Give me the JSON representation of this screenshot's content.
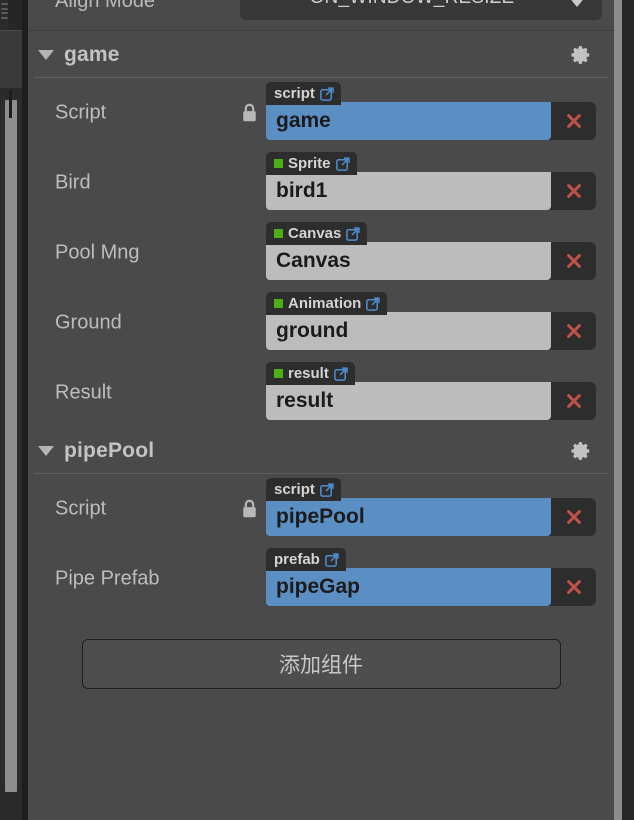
{
  "panel": {
    "name": "inspector-panel",
    "background_color": "#4a4a4a"
  },
  "top_property": {
    "label": "Align Mode",
    "dropdown_value": "ON_WINDOW_RESIZE",
    "caret_icon": "chevron-down-icon"
  },
  "sections": [
    {
      "title": "game",
      "collapsed": false,
      "fold_icon": "caret-down-icon",
      "gear_icon": "gear-icon",
      "rows": [
        {
          "label": "Script",
          "locked": true,
          "lock_icon": "lock-icon",
          "chip_text": "script",
          "chip_has_dot": false,
          "chip_link_icon": "external-link-icon",
          "value": "game",
          "value_style": "blue",
          "clear_icon": "close-x-icon"
        },
        {
          "label": "Bird",
          "locked": false,
          "chip_text": "Sprite",
          "chip_has_dot": true,
          "chip_dot_color": "#4caf16",
          "chip_link_icon": "external-link-icon",
          "value": "bird1",
          "value_style": "grey",
          "clear_icon": "close-x-icon"
        },
        {
          "label": "Pool Mng",
          "locked": false,
          "chip_text": "Canvas",
          "chip_has_dot": true,
          "chip_dot_color": "#4caf16",
          "chip_link_icon": "external-link-icon",
          "value": "Canvas",
          "value_style": "grey",
          "clear_icon": "close-x-icon"
        },
        {
          "label": "Ground",
          "locked": false,
          "chip_text": "Animation",
          "chip_has_dot": true,
          "chip_dot_color": "#4caf16",
          "chip_link_icon": "external-link-icon",
          "value": "ground",
          "value_style": "grey",
          "clear_icon": "close-x-icon"
        },
        {
          "label": "Result",
          "locked": false,
          "chip_text": "result",
          "chip_has_dot": true,
          "chip_dot_color": "#4caf16",
          "chip_link_icon": "external-link-icon",
          "value": "result",
          "value_style": "grey",
          "clear_icon": "close-x-icon"
        }
      ]
    },
    {
      "title": "pipePool",
      "collapsed": false,
      "fold_icon": "caret-down-icon",
      "gear_icon": "gear-icon",
      "rows": [
        {
          "label": "Script",
          "locked": true,
          "lock_icon": "lock-icon",
          "chip_text": "script",
          "chip_has_dot": false,
          "chip_link_icon": "external-link-icon",
          "value": "pipePool",
          "value_style": "blue",
          "clear_icon": "close-x-icon"
        },
        {
          "label": "Pipe Prefab",
          "locked": false,
          "chip_text": "prefab",
          "chip_has_dot": false,
          "chip_link_icon": "external-link-icon",
          "value": "pipeGap",
          "value_style": "blue",
          "clear_icon": "close-x-icon"
        }
      ]
    }
  ],
  "add_component_button": {
    "label": "添加组件"
  },
  "colors": {
    "panel_bg": "#4a4a4a",
    "chip_bg": "#2d2d2d",
    "value_blue": "#5b8fc4",
    "value_grey": "#bcbcbc",
    "accent_green": "#4caf16",
    "delete_red": "#c0504a",
    "link_blue": "#4f8fd0"
  }
}
